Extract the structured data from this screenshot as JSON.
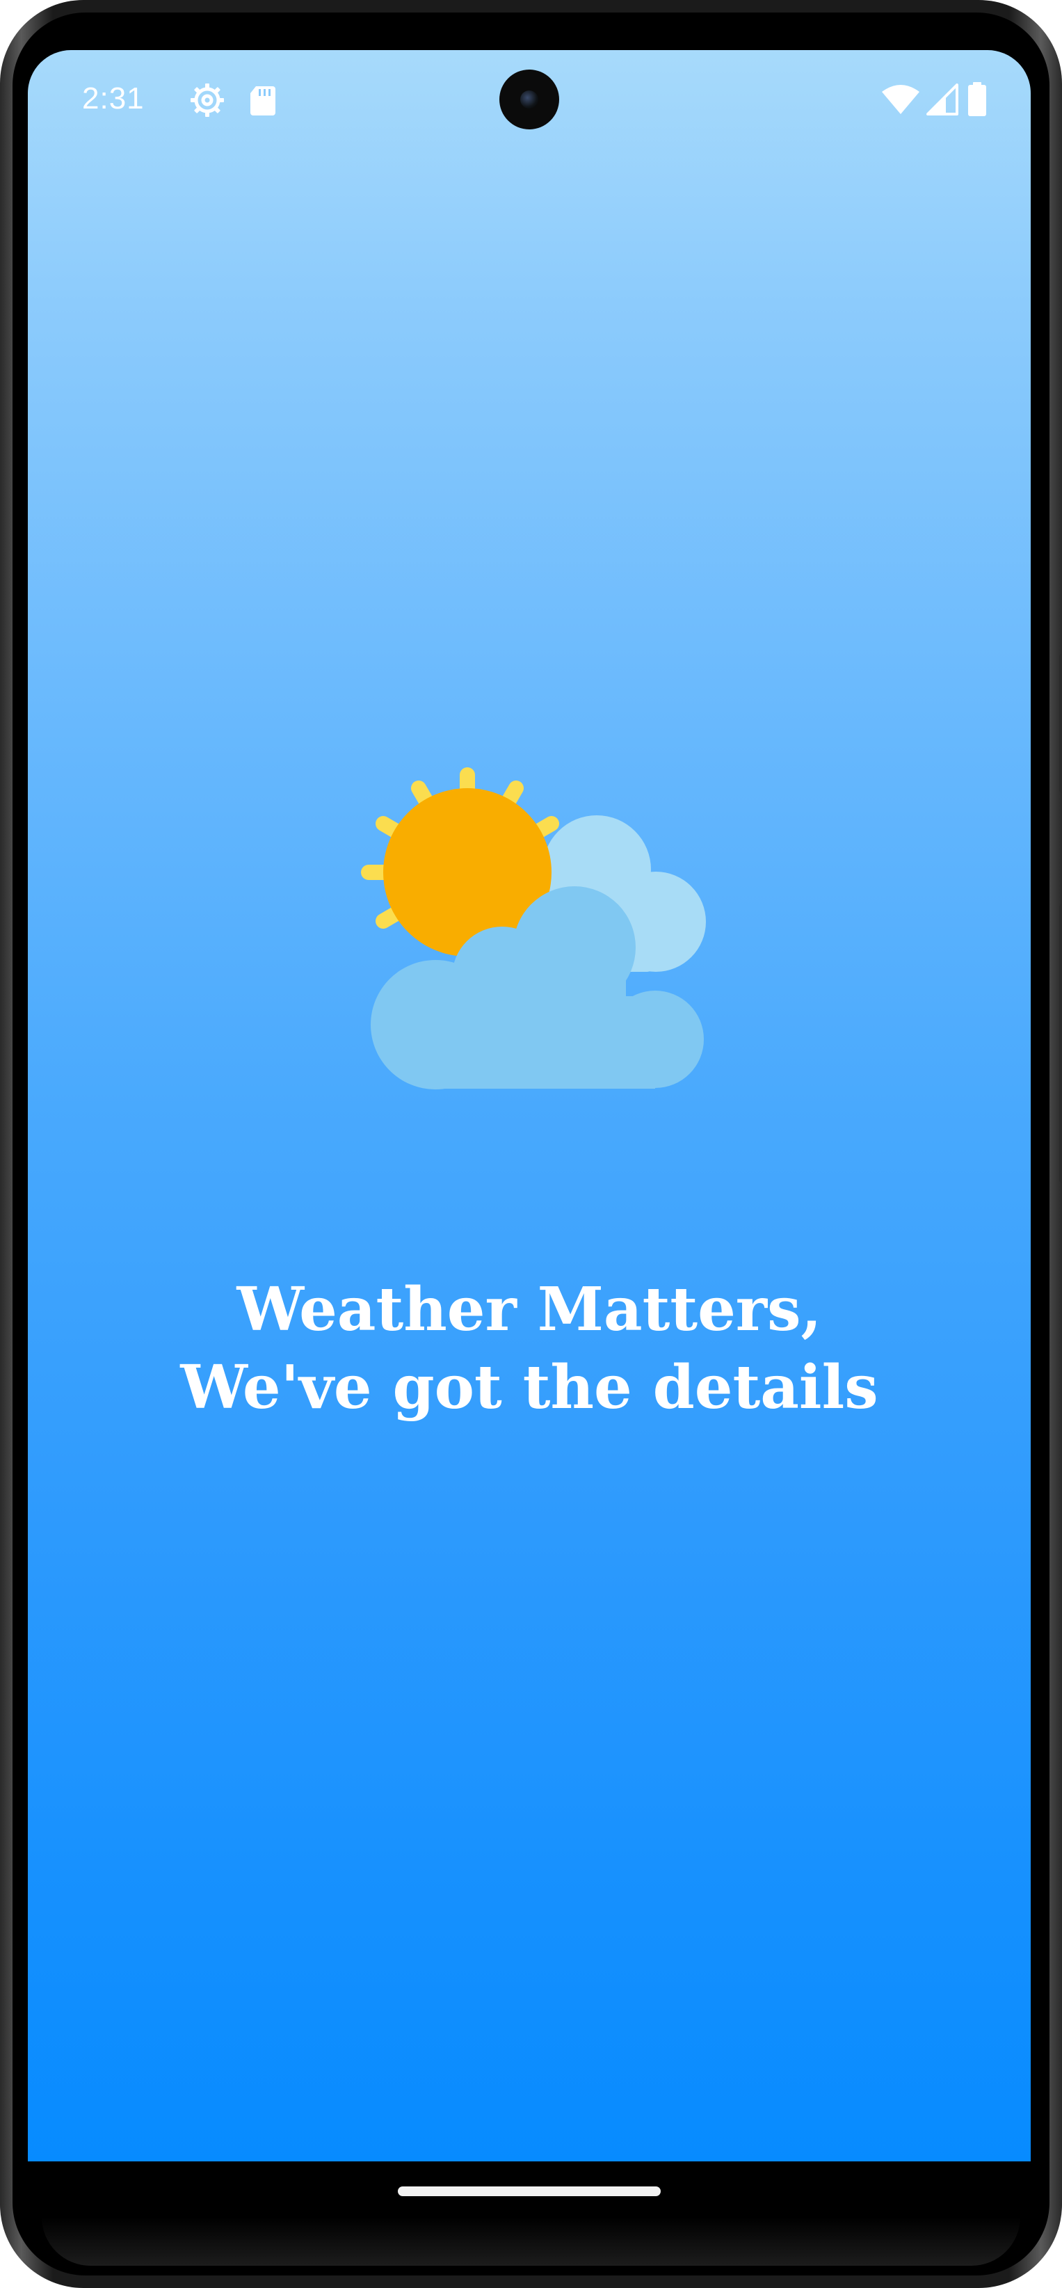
{
  "status_bar": {
    "time": "2:31",
    "left_icons": [
      "settings-gear-icon",
      "sd-card-icon"
    ],
    "right_icons": [
      "wifi-icon",
      "cell-signal-icon",
      "battery-icon"
    ]
  },
  "splash": {
    "illustration": "sun-behind-clouds-icon",
    "headline_line1": "Weather Matters,",
    "headline_line2": "We've got the details"
  },
  "colors": {
    "background_top": "#a7dafb",
    "background_bottom": "#078bff",
    "sun": "#f9ad00",
    "sun_rays": "#fbdd4f",
    "cloud_back": "#a8dcf6",
    "cloud_front": "#80c8f2",
    "text": "#ffffff"
  }
}
